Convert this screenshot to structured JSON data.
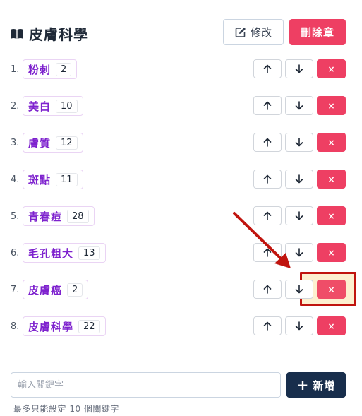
{
  "header": {
    "title": "皮膚科學",
    "edit_label": "修改",
    "delete_chapter_label": "刪除章"
  },
  "keywords": [
    {
      "index": "1.",
      "label": "粉刺",
      "count": "2"
    },
    {
      "index": "2.",
      "label": "美白",
      "count": "10"
    },
    {
      "index": "3.",
      "label": "膚質",
      "count": "12"
    },
    {
      "index": "4.",
      "label": "斑點",
      "count": "11"
    },
    {
      "index": "5.",
      "label": "青春痘",
      "count": "28"
    },
    {
      "index": "6.",
      "label": "毛孔粗大",
      "count": "13"
    },
    {
      "index": "7.",
      "label": "皮膚癌",
      "count": "2"
    },
    {
      "index": "8.",
      "label": "皮膚科學",
      "count": "22"
    }
  ],
  "row_buttons": {
    "remove_symbol": "×"
  },
  "form": {
    "placeholder": "輸入關鍵字",
    "value": "",
    "add_label": "新增",
    "add_symbol": "+",
    "hint": "最多只能設定 10 個關鍵字"
  },
  "annotation": {
    "color": "#c0140e",
    "target_row": 7
  },
  "colors": {
    "danger": "#ee3f63",
    "primary_dark": "#182e4c",
    "tag_text": "#7e22ce"
  }
}
